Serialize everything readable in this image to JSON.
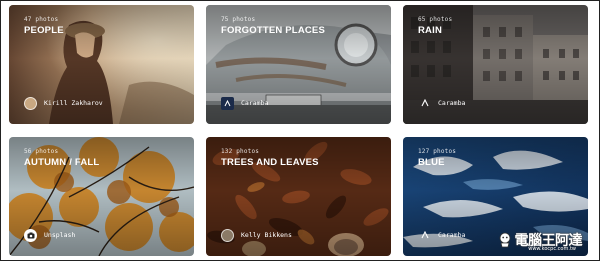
{
  "collections": [
    {
      "count": "47 photos",
      "title": "PEOPLE",
      "author": "Kirill Zakharov",
      "author_icon": "avatar"
    },
    {
      "count": "75 photos",
      "title": "FORGOTTEN PLACES",
      "author": "Caramba",
      "author_icon": "caramba-logo-icon"
    },
    {
      "count": "65 photos",
      "title": "RAIN",
      "author": "Caramba",
      "author_icon": "caramba-logo-icon"
    },
    {
      "count": "56 photos",
      "title": "AUTUMN / FALL",
      "author": "Unsplash",
      "author_icon": "camera-icon"
    },
    {
      "count": "132 photos",
      "title": "TREES AND LEAVES",
      "author": "Kelly Bikkens",
      "author_icon": "avatar"
    },
    {
      "count": "127 photos",
      "title": "BLUE",
      "author": "Caramba",
      "author_icon": "caramba-logo-icon"
    }
  ],
  "watermark": {
    "text": "電腦王阿達",
    "url": "www.kocpc.com.tw"
  }
}
